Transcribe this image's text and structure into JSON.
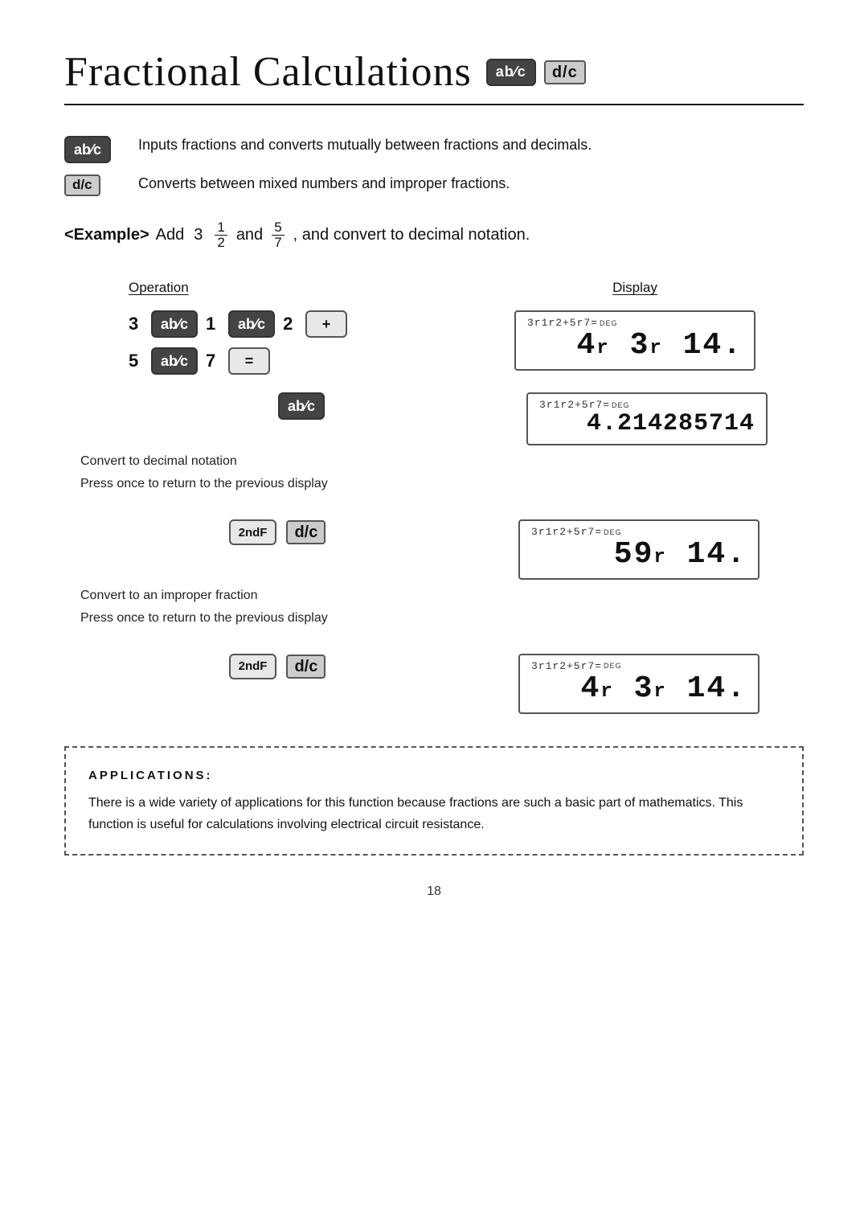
{
  "page": {
    "title": "Fractional Calculations",
    "page_number": "18"
  },
  "legend": {
    "ab_key_desc": "Inputs fractions and converts mutually between fractions and decimals.",
    "dc_key_desc": "Converts between mixed numbers and improper fractions."
  },
  "example": {
    "label": "<Example>",
    "text_before": "Add",
    "mixed_number": "3",
    "frac1_num": "1",
    "frac1_den": "2",
    "text_middle": "and",
    "frac2_num": "5",
    "frac2_den": "7",
    "text_after": ", and convert to decimal notation."
  },
  "operation_header": "Operation",
  "display_header": "Display",
  "steps": [
    {
      "id": "step1",
      "keys": [
        "3",
        "ab/c",
        "1",
        "ab/c",
        "2",
        "+",
        "5",
        "ab/c",
        "7",
        "="
      ],
      "display_top": "3r1r2+5r7=",
      "display_deg": "DEG",
      "display_bottom": "4r 3r 14.",
      "note_line1": "",
      "note_line2": ""
    },
    {
      "id": "step2",
      "keys": [
        "ab/c"
      ],
      "display_top": "3r1r2+5r7=",
      "display_deg": "DEG",
      "display_bottom": "4.214285714",
      "note_line1": "Convert to decimal notation",
      "note_line2": "Press once to return to the previous display"
    },
    {
      "id": "step3",
      "keys": [
        "2ndF",
        "d/c"
      ],
      "display_top": "3r1r2+5r7=",
      "display_deg": "DEG",
      "display_bottom": "59r 14.",
      "note_line1": "Convert to an improper fraction",
      "note_line2": "Press once to return to the previous display"
    },
    {
      "id": "step4",
      "keys": [
        "2ndF",
        "d/c"
      ],
      "display_top": "3r1r2+5r7=",
      "display_deg": "DEG",
      "display_bottom": "4r 3r 14.",
      "note_line1": "",
      "note_line2": ""
    }
  ],
  "applications": {
    "title": "APPLICATIONS:",
    "text": "There is a wide variety of applications for this function because fractions are such a basic part of mathematics. This function is useful for calculations involving electrical circuit resistance."
  }
}
